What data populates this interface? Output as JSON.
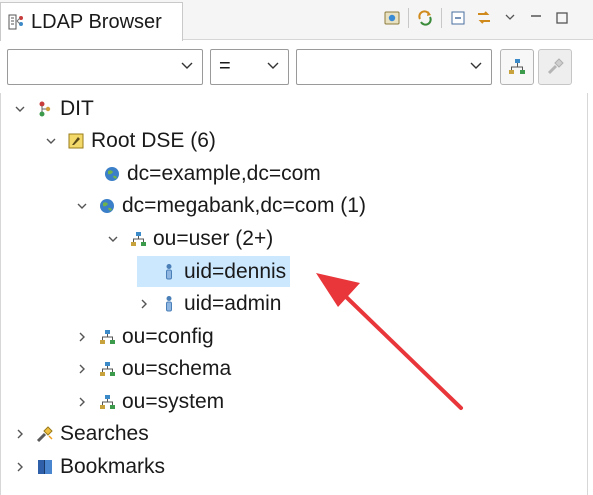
{
  "tab": {
    "title": "LDAP Browser"
  },
  "toolbar": {
    "icons": [
      "link-with-editor-icon",
      "refresh-icon",
      "collapse-all-icon",
      "filter-icon",
      "view-menu-icon",
      "minimize-icon",
      "maximize-icon"
    ]
  },
  "filter": {
    "attribute_value": "",
    "operator_value": "=",
    "text_value": ""
  },
  "tree": {
    "dit": "DIT",
    "root_dse": "Root DSE (6)",
    "dc_example": "dc=example,dc=com",
    "dc_megabank": "dc=megabank,dc=com (1)",
    "ou_user": "ou=user (2+)",
    "uid_dennis": "uid=dennis",
    "uid_admin": "uid=admin",
    "ou_config": "ou=config",
    "ou_schema": "ou=schema",
    "ou_system": "ou=system",
    "searches": "Searches",
    "bookmarks": "Bookmarks"
  },
  "colors": {
    "selection": "#cce8ff",
    "annotation_arrow": "#e8363a"
  }
}
